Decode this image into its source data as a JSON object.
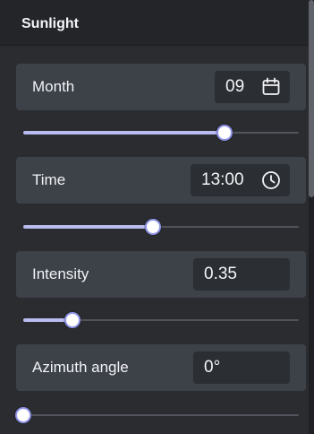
{
  "panel": {
    "title": "Sunlight"
  },
  "controls": [
    {
      "label": "Month",
      "value": "09",
      "icon": "calendar-icon",
      "slider_value": 0.73
    },
    {
      "label": "Time",
      "value": "13:00",
      "icon": "clock-icon",
      "slider_value": 0.47
    },
    {
      "label": "Intensity",
      "value": "0.35",
      "slider_value": 0.18
    },
    {
      "label": "Azimuth angle",
      "value": "0°",
      "slider_value": 0.0
    }
  ],
  "colors": {
    "accent": "#b8bcef",
    "thumb_border": "#8e93e6",
    "row_background": "#3d4148",
    "field_background": "#2b2e33",
    "panel_background": "#2a2c30"
  }
}
